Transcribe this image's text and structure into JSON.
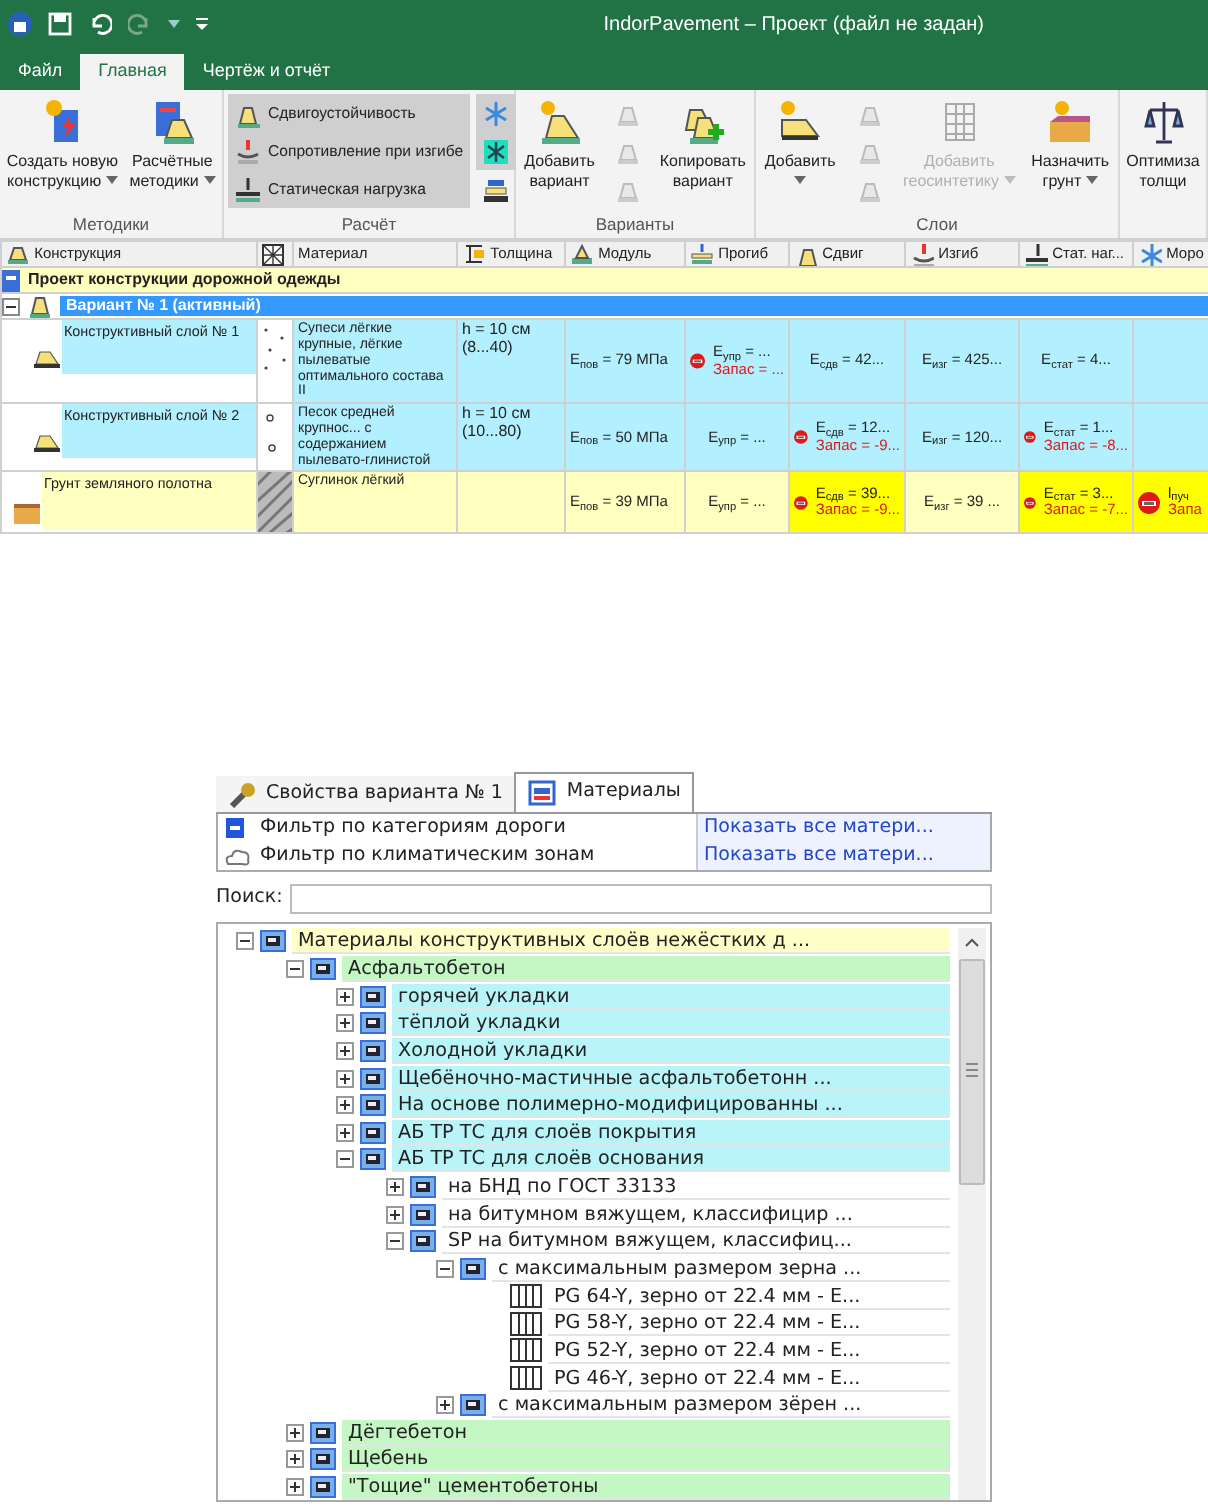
{
  "window": {
    "title": "IndorPavement – Проект (файл не задан)"
  },
  "menu_tabs": [
    {
      "label": "Файл",
      "selected": false
    },
    {
      "label": "Главная",
      "selected": true
    },
    {
      "label": "Чертёж и отчёт",
      "selected": false
    }
  ],
  "ribbon": {
    "groups": [
      {
        "label": "Методики",
        "items": [
          {
            "kind": "large",
            "lines": [
              "Создать новую",
              "конструкцию"
            ],
            "dropdown": true,
            "disabled": false
          },
          {
            "kind": "large",
            "lines": [
              "Расчётные",
              "методики"
            ],
            "dropdown": true,
            "disabled": false
          }
        ]
      },
      {
        "label": "Расчёт",
        "items": [
          {
            "kind": "list",
            "entries": [
              {
                "label": "Сдвигоустойчивость",
                "selected": true
              },
              {
                "label": "Сопротивление при изгибе",
                "selected": true
              },
              {
                "label": "Статическая нагрузка",
                "selected": true
              }
            ]
          },
          {
            "kind": "icons",
            "entries": [
              {
                "selected": true,
                "disabled": false
              },
              {
                "selected": true,
                "disabled": false
              },
              {
                "selected": false,
                "disabled": false
              }
            ]
          }
        ]
      },
      {
        "label": "Варианты",
        "items": [
          {
            "kind": "large",
            "lines": [
              "Добавить",
              "вариант"
            ],
            "dropdown": false,
            "disabled": false
          },
          {
            "kind": "icons",
            "entries": [
              {
                "selected": false,
                "disabled": true
              },
              {
                "selected": false,
                "disabled": true
              },
              {
                "selected": false,
                "disabled": true
              }
            ]
          },
          {
            "kind": "large",
            "lines": [
              "Копировать",
              "вариант"
            ],
            "dropdown": false,
            "disabled": false
          }
        ]
      },
      {
        "label": "Слои",
        "items": [
          {
            "kind": "large",
            "lines": [
              "Добавить"
            ],
            "dropdown": true,
            "disabled": false
          },
          {
            "kind": "icons",
            "entries": [
              {
                "selected": false,
                "disabled": true
              },
              {
                "selected": false,
                "disabled": true
              },
              {
                "selected": false,
                "disabled": true
              }
            ]
          },
          {
            "kind": "large",
            "lines": [
              "Добавить",
              "геосинтетику"
            ],
            "dropdown": true,
            "disabled": true
          },
          {
            "kind": "large",
            "lines": [
              "Назначить",
              "грунт"
            ],
            "dropdown": true,
            "disabled": false
          }
        ]
      },
      {
        "items": [
          {
            "kind": "large",
            "lines": [
              "Оптимиза",
              "толщи"
            ],
            "dropdown": false,
            "disabled": false
          }
        ]
      }
    ]
  },
  "table": {
    "columns": [
      {
        "label": "Конструкция"
      },
      {
        "kind": "pattern"
      },
      {
        "label": "Материал"
      },
      {
        "label": "Толщина"
      },
      {
        "label": "Модуль"
      },
      {
        "label": "Прогиб"
      },
      {
        "label": "Сдвиг"
      },
      {
        "label": "Изгиб"
      },
      {
        "label": "Стат. наг..."
      },
      {
        "label": "Моро"
      }
    ],
    "rows": [
      {
        "kind": "project",
        "label": "Проект конструкции дорожной одежды"
      },
      {
        "kind": "variant",
        "label": "Вариант № 1 (активный)",
        "expanded": true
      },
      {
        "kind": "layer",
        "label": "Конструктивный слой № 1",
        "material": {
          "kind": "dots",
          "text": "Супеси лёгкие крупные, лёгкие пылеватые оптимального состава II"
        },
        "thickness": [
          "h = 10 см",
          "(8...40)"
        ],
        "modulus": "E$_{пов}$ = 79 МПа",
        "checks": [
          {
            "failed": true,
            "highlight": false,
            "value": "E$_{упр}$ = ...",
            "reserve": "Запас = ..."
          },
          {
            "failed": false,
            "highlight": false,
            "value": "E$_{сдв}$ = 42..."
          },
          {
            "failed": false,
            "highlight": false,
            "value": "E$_{изг}$ = 425..."
          },
          {
            "failed": false,
            "highlight": false,
            "value": "E$_{стат}$ = 4..."
          }
        ]
      },
      {
        "kind": "layer",
        "label": "Конструктивный слой № 2",
        "material": {
          "kind": "circles",
          "text": "Песок средней крупнос... с содержанием пылевато-глинистой"
        },
        "thickness": [
          "h = 10 см",
          "(10...80)"
        ],
        "modulus": "E$_{пов}$ = 50 МПа",
        "checks": [
          {
            "failed": false,
            "highlight": false,
            "value": "E$_{упр}$ = ..."
          },
          {
            "failed": true,
            "highlight": false,
            "value": "E$_{сдв}$ = 12...",
            "reserve": "Запас = -9..."
          },
          {
            "failed": false,
            "highlight": false,
            "value": "E$_{изг}$ = 120..."
          },
          {
            "failed": true,
            "highlight": false,
            "value": "E$_{стат}$ = 1...",
            "reserve": "Запас = -8..."
          }
        ]
      },
      {
        "kind": "ground",
        "label": "Грунт земляного полотна",
        "material": {
          "kind": "hatch",
          "text": "Суглинок лёгкий"
        },
        "modulus": "E$_{пов}$ = 39 МПа",
        "checks": [
          {
            "failed": false,
            "highlight": false,
            "value": "E$_{упр}$ = ..."
          },
          {
            "failed": true,
            "highlight": true,
            "value": "E$_{сдв}$ = 39...",
            "reserve": "Запас = -9..."
          },
          {
            "failed": false,
            "highlight": false,
            "value": "E$_{изг}$ = 39 ..."
          },
          {
            "failed": true,
            "highlight": true,
            "value": "E$_{стат}$ = 3...",
            "reserve": "Запас = -7..."
          },
          {
            "failed": true,
            "highlight": true,
            "value": "l$_{пуч}$",
            "reserve": "Запа"
          }
        ]
      }
    ]
  },
  "materials_panel": {
    "tabs": [
      {
        "label": "Свойства варианта № 1",
        "selected": false
      },
      {
        "label": "Материалы",
        "selected": true
      }
    ],
    "filters": [
      {
        "label": "Фильтр по категориям дороги",
        "link": "Показать все матери..."
      },
      {
        "label": "Фильтр по климатическим зонам",
        "link": "Показать все матери..."
      }
    ],
    "search": {
      "label": "Поиск:"
    },
    "tree": [
      {
        "kind": "group",
        "label": "Материалы конструктивных слоёв нежёстких д ...",
        "color": "#ffffc8",
        "expanded": true,
        "children": [
          {
            "kind": "group",
            "label": "Асфальтобетон",
            "color": "#c4f7c4",
            "expanded": true,
            "children": [
              {
                "kind": "group",
                "label": "горячей укладки",
                "color": "#b8f4f8",
                "expanded": false
              },
              {
                "kind": "group",
                "label": "тёплой укладки",
                "color": "#b8f4f8",
                "expanded": false
              },
              {
                "kind": "group",
                "label": "Холодной укладки",
                "color": "#b8f4f8",
                "expanded": false
              },
              {
                "kind": "group",
                "label": "Щебёночно-мастичные асфальтобетонн ...",
                "color": "#b8f4f8",
                "expanded": false
              },
              {
                "kind": "group",
                "label": "На основе полимерно-модифицированны ...",
                "color": "#b8f4f8",
                "expanded": false
              },
              {
                "kind": "group",
                "label": "АБ ТР ТС для слоёв покрытия",
                "color": "#b8f4f8",
                "expanded": false
              },
              {
                "kind": "group",
                "label": "АБ ТР ТС для слоёв основания",
                "color": "#b8f4f8",
                "expanded": true,
                "children": [
                  {
                    "kind": "group",
                    "label": "на БНД по ГОСТ 33133",
                    "color": "#ffffff",
                    "expanded": false
                  },
                  {
                    "kind": "group",
                    "label": " на битумном вяжущем, классифицир ...",
                    "color": "#ffffff",
                    "expanded": false
                  },
                  {
                    "kind": "group",
                    "label": "SP на битумном вяжущем, классифиц...",
                    "color": "#ffffff",
                    "expanded": true,
                    "children": [
                      {
                        "kind": "group",
                        "label": "с максимальным размером зерна ...",
                        "color": "#ffffff",
                        "expanded": true,
                        "children": [
                          {
                            "kind": "material",
                            "label": "PG 64-Y, зерно от 22.4 мм - E...",
                            "color": "#ffffff"
                          },
                          {
                            "kind": "material",
                            "label": "PG 58-Y, зерно от 22.4 мм - E...",
                            "color": "#ffffff"
                          },
                          {
                            "kind": "material",
                            "label": "PG 52-Y, зерно от 22.4 мм - E...",
                            "color": "#ffffff"
                          },
                          {
                            "kind": "material",
                            "label": "PG 46-Y, зерно от 22.4 мм - E...",
                            "color": "#ffffff"
                          }
                        ]
                      },
                      {
                        "kind": "group",
                        "label": "с максимальным размером зёрен ...",
                        "color": "#ffffff",
                        "expanded": false
                      }
                    ]
                  }
                ]
              }
            ]
          },
          {
            "kind": "group",
            "label": "Дёгтебетон",
            "color": "#c4f7c4",
            "expanded": false
          },
          {
            "kind": "group",
            "label": "Щебень",
            "color": "#c4f7c4",
            "expanded": false
          },
          {
            "kind": "group",
            "label": "\"Тощие\" цементобетоны",
            "color": "#c4f7c4",
            "expanded": false
          }
        ]
      }
    ]
  }
}
